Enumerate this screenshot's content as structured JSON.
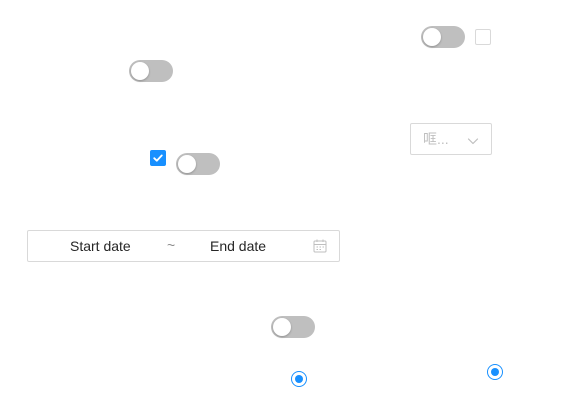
{
  "switches": [
    {
      "id": "switch-1",
      "checked": false
    },
    {
      "id": "switch-2",
      "checked": false
    },
    {
      "id": "switch-3",
      "checked": false
    },
    {
      "id": "switch-4",
      "checked": false
    }
  ],
  "checkboxes": [
    {
      "id": "checkbox-1",
      "checked": false
    },
    {
      "id": "checkbox-2",
      "checked": true
    }
  ],
  "select": {
    "placeholder": "哐...",
    "icon": "chevron-down-icon"
  },
  "date_range": {
    "start_placeholder": "Start date",
    "separator": "~",
    "end_placeholder": "End date",
    "icon": "calendar-icon"
  },
  "radios": [
    {
      "id": "radio-1",
      "checked": true
    },
    {
      "id": "radio-2",
      "checked": true
    }
  ],
  "colors": {
    "primary": "#1890ff",
    "switch_off": "#bfbfbf",
    "border": "#d9d9d9",
    "placeholder": "#bfbfbf"
  }
}
